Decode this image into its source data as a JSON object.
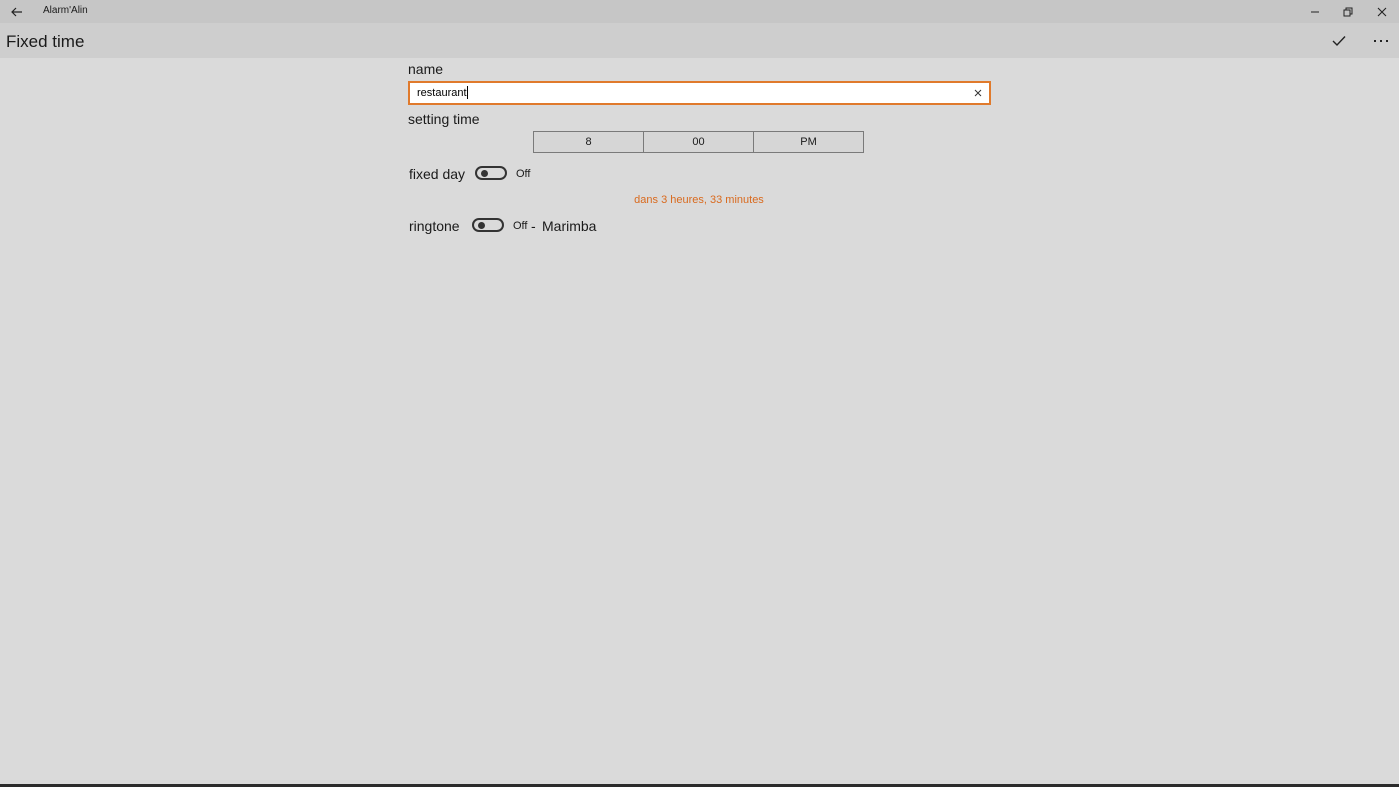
{
  "window": {
    "app_title": "Alarm'Alin"
  },
  "header": {
    "title": "Fixed time"
  },
  "form": {
    "name_label": "name",
    "name_value": "restaurant",
    "setting_time_label": "setting time",
    "time": {
      "hour": "8",
      "minute": "00",
      "period": "PM"
    },
    "fixed_day_label": "fixed day",
    "fixed_day_state": "Off",
    "countdown": "dans 3 heures, 33 minutes",
    "ringtone_label": "ringtone",
    "ringtone_state": "Off",
    "ringtone_separator": "-",
    "ringtone_name": "Marimba"
  },
  "icons": {
    "back": "back-arrow-icon",
    "minimize": "minimize-icon",
    "maximize": "restore-icon",
    "close": "close-icon",
    "accept": "checkmark-icon",
    "more": "more-icon",
    "clear": "clear-icon"
  },
  "colors": {
    "accent": "#e07a2c",
    "countdown": "#d96a1e",
    "background": "#dadada"
  }
}
